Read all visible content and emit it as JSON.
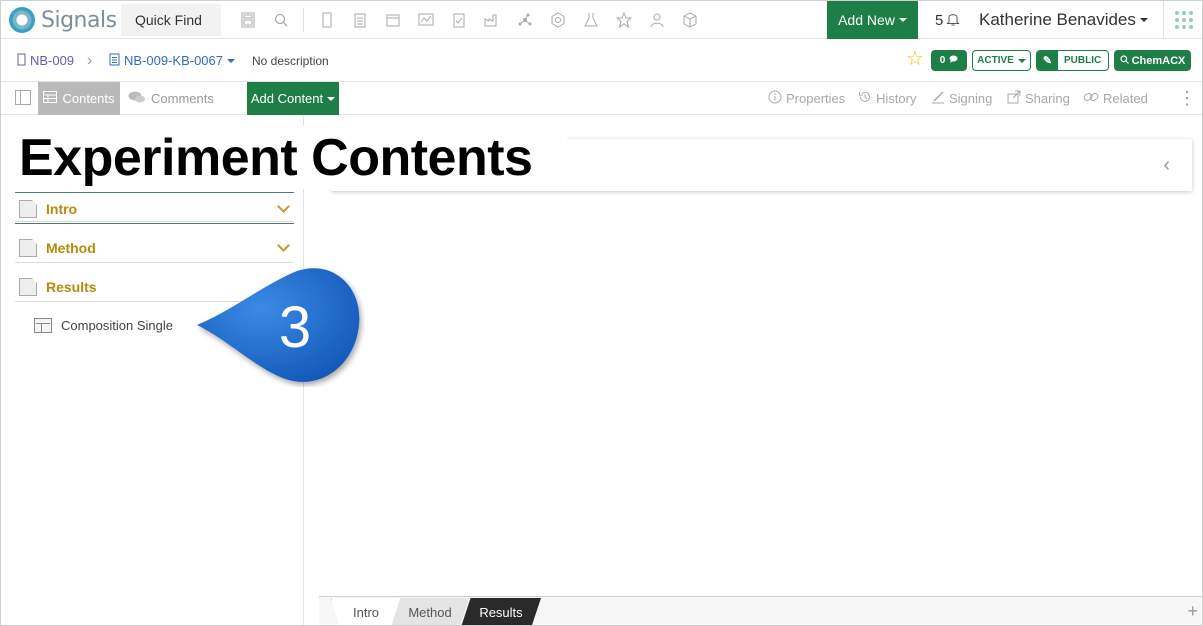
{
  "app": {
    "name": "Signals"
  },
  "topbar": {
    "quick_find": "Quick Find",
    "add_new": "Add New",
    "notification_count": "5",
    "user_name": "Katherine Benavides"
  },
  "breadcrumb": {
    "notebook": "NB-009",
    "experiment": "NB-009-KB-0067",
    "description": "No description"
  },
  "badges": {
    "comment_count": "0",
    "status": "ACTIVE",
    "visibility": "PUBLIC",
    "chem": "ChemACX"
  },
  "toolbar": {
    "contents": "Contents",
    "comments": "Comments",
    "add_content": "Add Content",
    "properties": "Properties",
    "history": "History",
    "signing": "Signing",
    "sharing": "Sharing",
    "related": "Related"
  },
  "sidebar": {
    "sections": [
      {
        "label": "Intro"
      },
      {
        "label": "Method"
      },
      {
        "label": "Results"
      }
    ],
    "results_item": "Composition Single"
  },
  "bottom_tabs": [
    "Intro",
    "Method",
    "Results"
  ],
  "overlay": {
    "title": "Experiment Contents",
    "callout_number": "3"
  },
  "colors": {
    "brand_green": "#1e7e45",
    "section_gold": "#b88a0a",
    "callout_blue": "#1f6fd0"
  }
}
